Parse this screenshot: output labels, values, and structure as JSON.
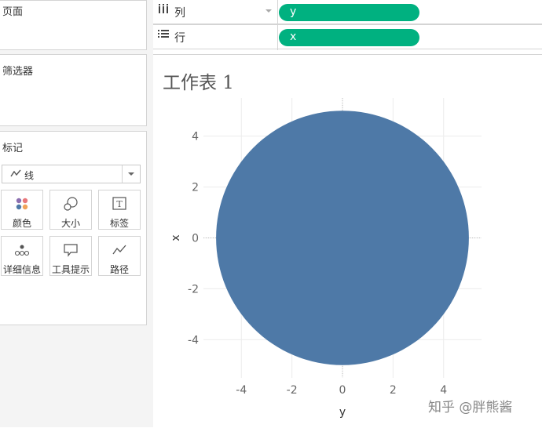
{
  "left_panel": {
    "pages_title": "页面",
    "filters_title": "筛选器",
    "marks_title": "标记",
    "mark_type": "线",
    "mark_buttons": [
      {
        "label": "颜色",
        "icon": "color-dots-icon"
      },
      {
        "label": "大小",
        "icon": "size-icon"
      },
      {
        "label": "标签",
        "icon": "label-icon"
      },
      {
        "label": "详细信息",
        "icon": "detail-icon"
      },
      {
        "label": "工具提示",
        "icon": "tooltip-icon"
      },
      {
        "label": "路径",
        "icon": "path-icon"
      }
    ]
  },
  "shelves": {
    "columns": {
      "label": "列",
      "icon": "columns-icon",
      "pill": "y"
    },
    "rows": {
      "label": "行",
      "icon": "rows-icon",
      "pill": "x"
    }
  },
  "sheet": {
    "title": "工作表 1"
  },
  "chart_data": {
    "type": "scatter",
    "shape": "filled circle",
    "center": [
      0,
      0
    ],
    "radius": 5,
    "xlabel": "y",
    "ylabel": "x",
    "xlim": [
      -5.5,
      5.5
    ],
    "ylim": [
      -5.5,
      5.5
    ],
    "xticks": [
      -4,
      -2,
      0,
      2,
      4
    ],
    "yticks": [
      4,
      2,
      0,
      -2,
      -4
    ],
    "x_tick_labels": [
      "-4",
      "-2",
      "0",
      "2",
      "4"
    ],
    "y_tick_labels": [
      "4",
      "2",
      "0",
      "-2",
      "-4"
    ],
    "grid": true,
    "color": "#4e79a7"
  },
  "watermark": "知乎 @胖熊酱",
  "colors": {
    "pill": "#00b180",
    "mark": "#4e79a7"
  }
}
